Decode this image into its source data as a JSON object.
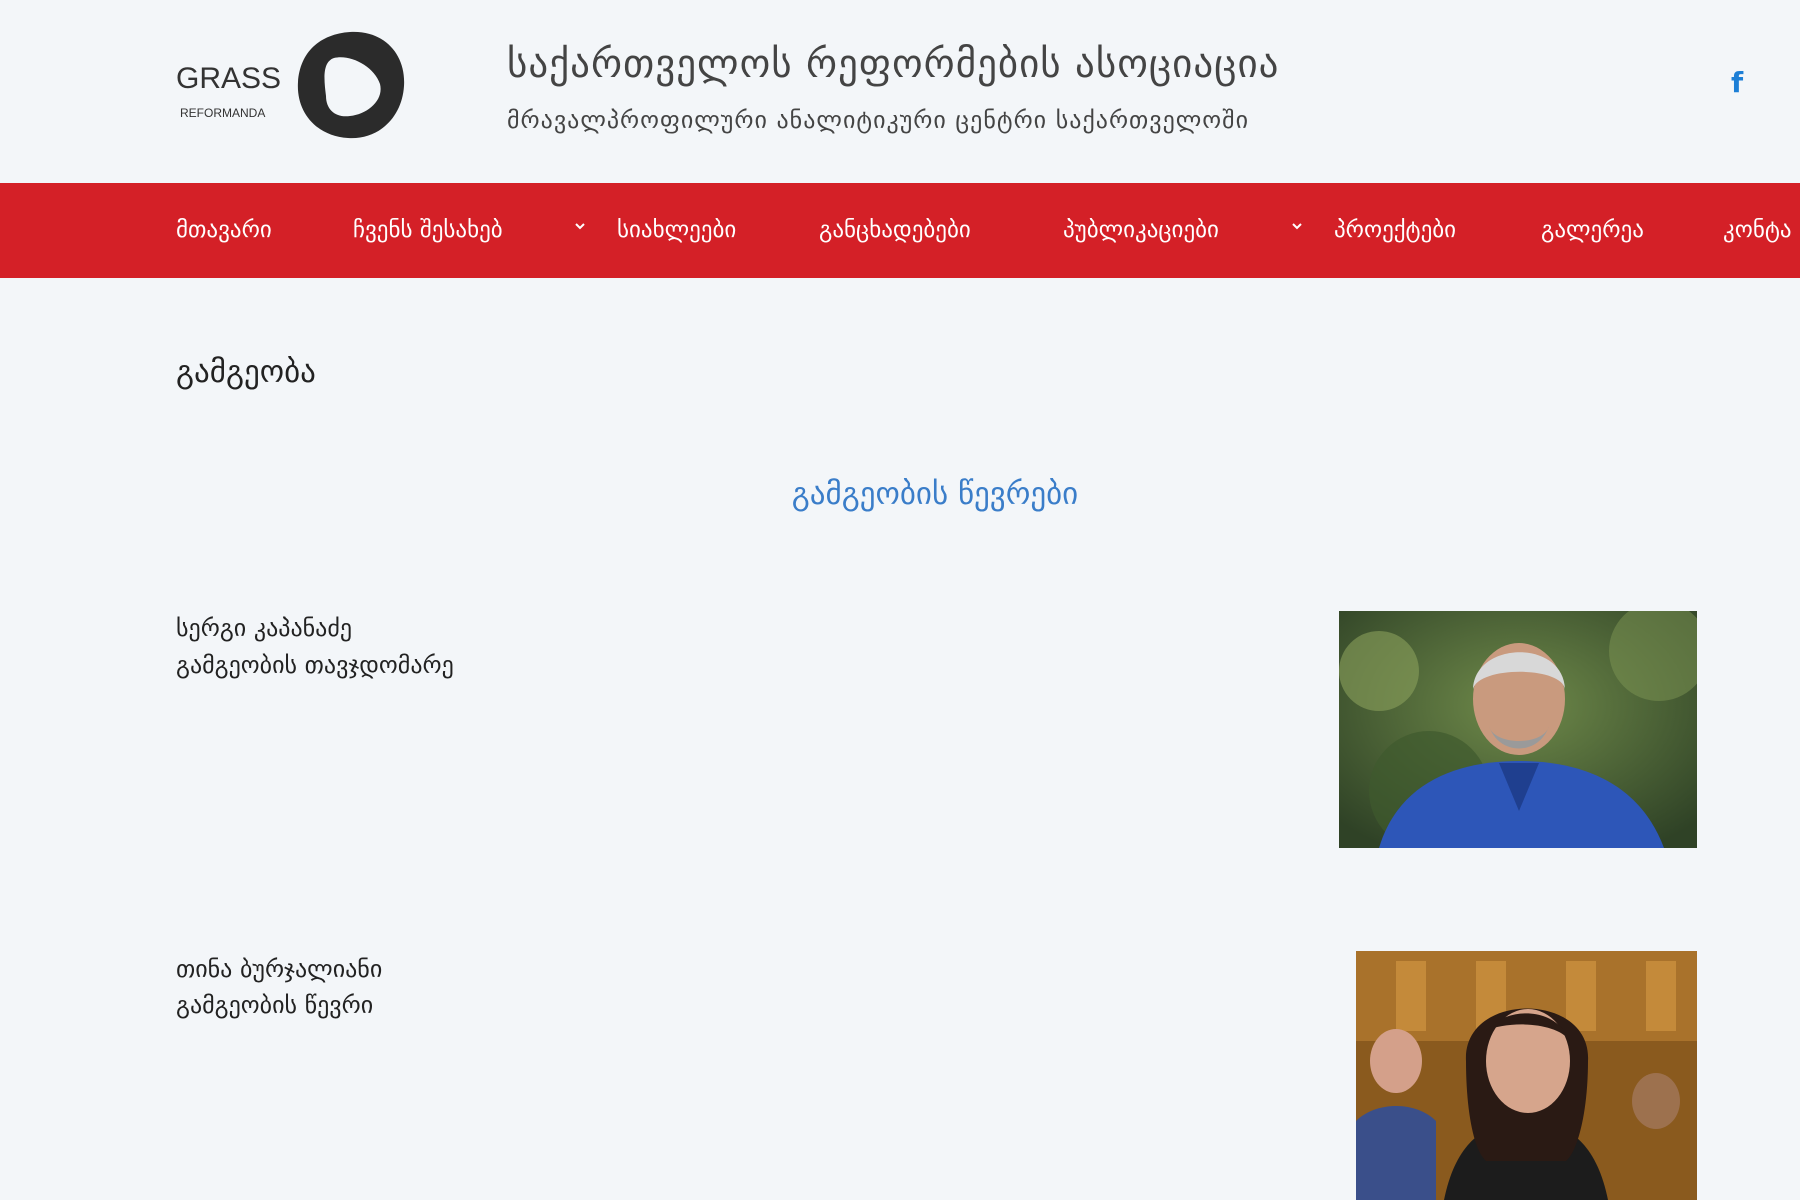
{
  "header": {
    "logo": {
      "text": "GRASS",
      "subtext": "REFORMANDA"
    },
    "title": "საქართველოს რეფორმების ასოციაცია",
    "subtitle": "მრავალპროფილური ანალიტიკური ცენტრი საქართველოში",
    "social": [
      {
        "icon": "facebook-icon",
        "glyph": "f"
      }
    ]
  },
  "nav": {
    "items": [
      {
        "label": "მთავარი",
        "dropdown": false
      },
      {
        "label": "ჩვენს შესახებ",
        "dropdown": true
      },
      {
        "label": "სიახლეები",
        "dropdown": false
      },
      {
        "label": "განცხადებები",
        "dropdown": false
      },
      {
        "label": "პუბლიკაციები",
        "dropdown": true
      },
      {
        "label": "პროექტები",
        "dropdown": false
      },
      {
        "label": "გალერეა",
        "dropdown": false
      },
      {
        "label": "კონტა",
        "dropdown": false
      }
    ]
  },
  "content": {
    "page_title": "გამგეობა",
    "section_heading": "გამგეობის წევრები",
    "members": [
      {
        "name": "სერგი კაპანაძე",
        "role": "გამგეობის თავჯდომარე",
        "photo": "portrait-photo-man"
      },
      {
        "name": "თინა ბურჯალიანი",
        "role": "გამგეობის წევრი",
        "photo": "portrait-photo-woman"
      }
    ]
  },
  "colors": {
    "nav_background": "#d42027",
    "accent_heading": "#3a7dc9",
    "facebook": "#1d7fd6",
    "page_background": "#f3f6f9"
  }
}
